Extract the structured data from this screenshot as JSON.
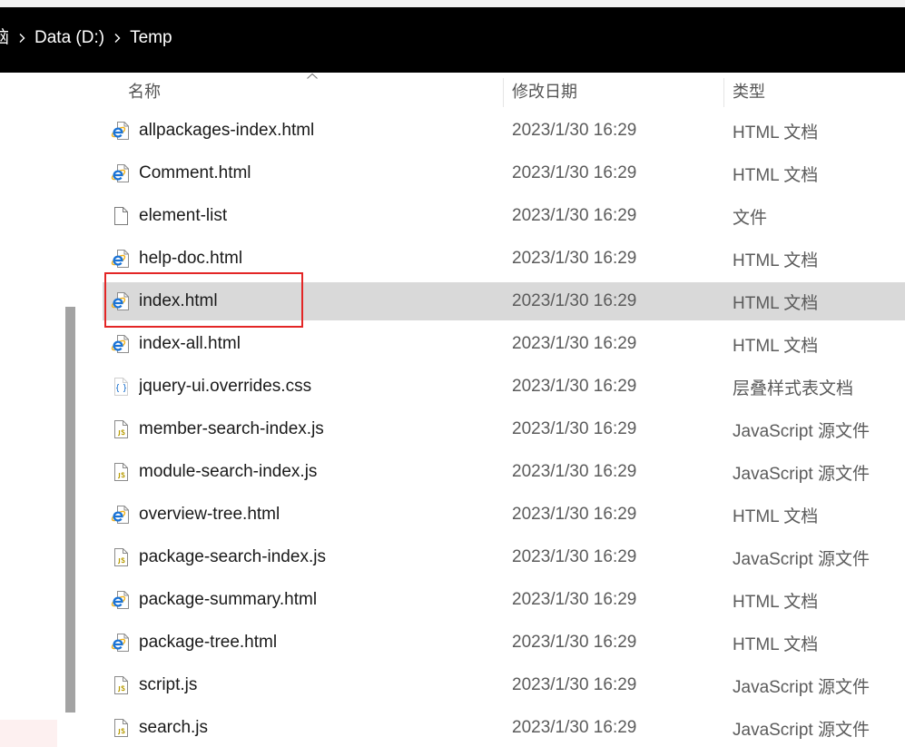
{
  "breadcrumb": {
    "items": [
      "脑",
      "Data (D:)",
      "Temp"
    ],
    "separator_icon": "chevron-right-icon"
  },
  "columns": {
    "name": "名称",
    "modified": "修改日期",
    "type": "类型",
    "sort_icon": "sort-up-icon"
  },
  "files": [
    {
      "name": "allpackages-index.html",
      "modified": "2023/1/30 16:29",
      "type": "HTML 文档",
      "icon": "html-file-icon"
    },
    {
      "name": "Comment.html",
      "modified": "2023/1/30 16:29",
      "type": "HTML 文档",
      "icon": "html-file-icon"
    },
    {
      "name": "element-list",
      "modified": "2023/1/30 16:29",
      "type": "文件",
      "icon": "blank-file-icon"
    },
    {
      "name": "help-doc.html",
      "modified": "2023/1/30 16:29",
      "type": "HTML 文档",
      "icon": "html-file-icon"
    },
    {
      "name": "index.html",
      "modified": "2023/1/30 16:29",
      "type": "HTML 文档",
      "icon": "html-file-icon",
      "selected": true
    },
    {
      "name": "index-all.html",
      "modified": "2023/1/30 16:29",
      "type": "HTML 文档",
      "icon": "html-file-icon"
    },
    {
      "name": "jquery-ui.overrides.css",
      "modified": "2023/1/30 16:29",
      "type": "层叠样式表文档",
      "icon": "css-file-icon"
    },
    {
      "name": "member-search-index.js",
      "modified": "2023/1/30 16:29",
      "type": "JavaScript 源文件",
      "icon": "js-file-icon"
    },
    {
      "name": "module-search-index.js",
      "modified": "2023/1/30 16:29",
      "type": "JavaScript 源文件",
      "icon": "js-file-icon"
    },
    {
      "name": "overview-tree.html",
      "modified": "2023/1/30 16:29",
      "type": "HTML 文档",
      "icon": "html-file-icon"
    },
    {
      "name": "package-search-index.js",
      "modified": "2023/1/30 16:29",
      "type": "JavaScript 源文件",
      "icon": "js-file-icon"
    },
    {
      "name": "package-summary.html",
      "modified": "2023/1/30 16:29",
      "type": "HTML 文档",
      "icon": "html-file-icon"
    },
    {
      "name": "package-tree.html",
      "modified": "2023/1/30 16:29",
      "type": "HTML 文档",
      "icon": "html-file-icon"
    },
    {
      "name": "script.js",
      "modified": "2023/1/30 16:29",
      "type": "JavaScript 源文件",
      "icon": "js-file-icon"
    },
    {
      "name": "search.js",
      "modified": "2023/1/30 16:29",
      "type": "JavaScript 源文件",
      "icon": "js-file-icon"
    }
  ],
  "colors": {
    "title_bar": "#000000",
    "selected_row": "#d9d9d9",
    "annotation": "#e32626"
  }
}
